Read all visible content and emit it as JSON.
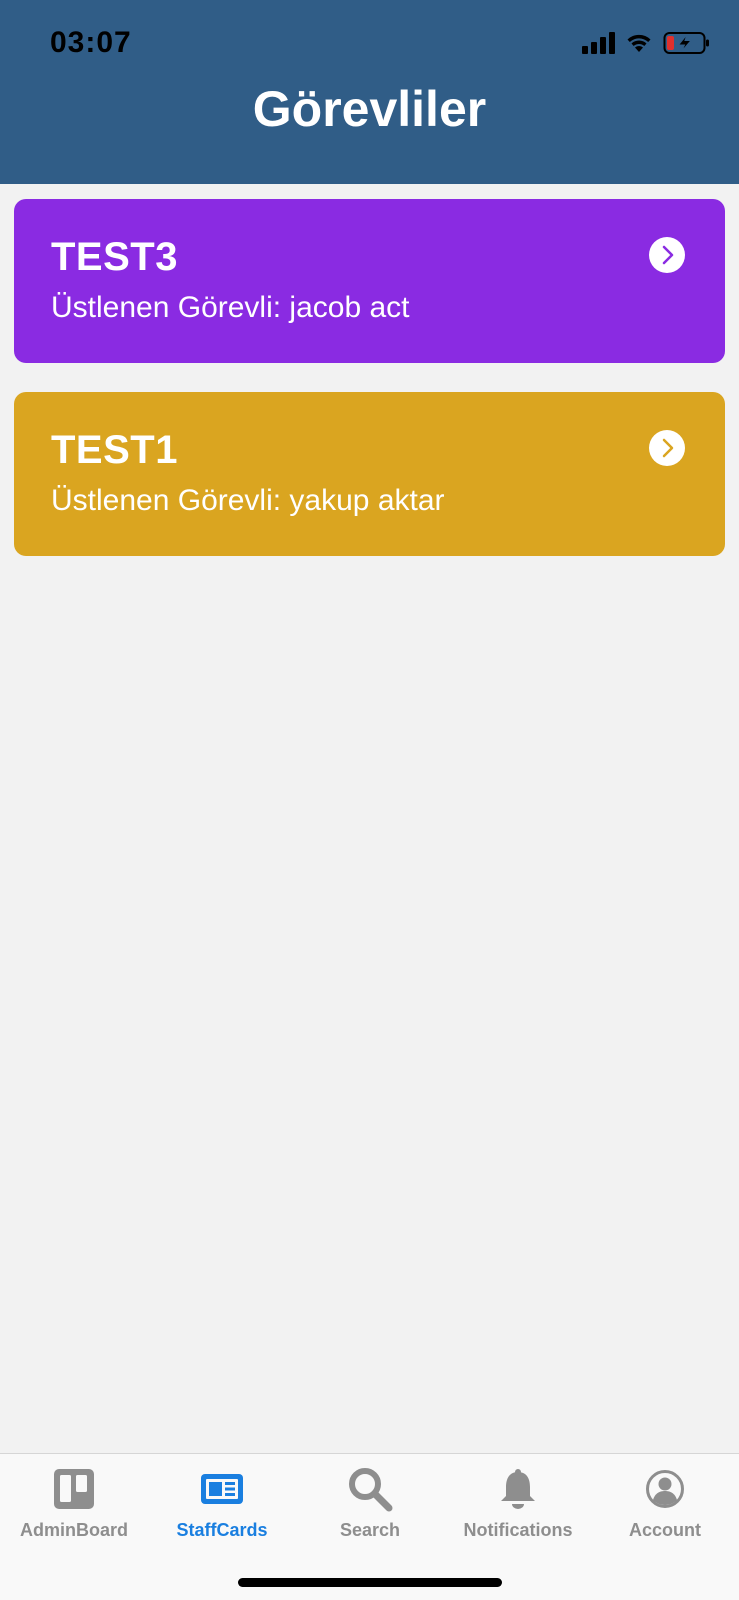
{
  "status_bar": {
    "time": "03:07"
  },
  "header": {
    "title": "Görevliler",
    "background": "#305d87"
  },
  "cards": [
    {
      "title": "TEST3",
      "subtitle": "Üstlenen Görevli: jacob act",
      "color": "#8a2be2",
      "icon": "chevron-right-circle-icon"
    },
    {
      "title": "TEST1",
      "subtitle": "Üstlenen Görevli: yakup aktar",
      "color": "#daa520",
      "icon": "chevron-right-circle-icon"
    }
  ],
  "tabbar": {
    "active_color": "#1a7fe0",
    "inactive_color": "#8e8e8e",
    "tabs": [
      {
        "label": "AdminBoard",
        "icon": "board-icon",
        "active": false
      },
      {
        "label": "StaffCards",
        "icon": "cards-icon",
        "active": true
      },
      {
        "label": "Search",
        "icon": "search-icon",
        "active": false
      },
      {
        "label": "Notifications",
        "icon": "bell-icon",
        "active": false
      },
      {
        "label": "Account",
        "icon": "account-icon",
        "active": false
      }
    ]
  }
}
